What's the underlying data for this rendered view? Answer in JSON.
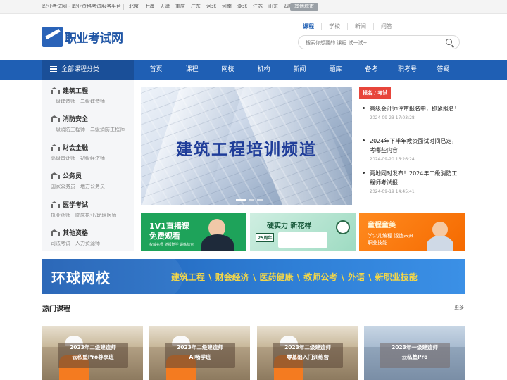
{
  "topbar": {
    "site_text": "职业考试网 - 职业资格考试服务平台",
    "cities": [
      "北京",
      "上海",
      "天津",
      "重庆",
      "广东",
      "河北",
      "河南",
      "湖北",
      "江苏",
      "山东",
      "四川"
    ],
    "more_city": "其他城市"
  },
  "logo": {
    "text": "职业考试网"
  },
  "header_tabs": [
    "课程",
    "学校",
    "新闻",
    "问答"
  ],
  "search": {
    "placeholder": "搜索你想要的 课程 试一试~"
  },
  "nav": {
    "all_categories": "全部课程分类",
    "items": [
      "首页",
      "课程",
      "网校",
      "机构",
      "新闻",
      "题库",
      "备考",
      "职考号",
      "答疑"
    ]
  },
  "sidebar": {
    "categories": [
      {
        "title": "建筑工程",
        "subs": [
          "一级建造师",
          "二级建造师"
        ]
      },
      {
        "title": "消防安全",
        "subs": [
          "一级消防工程师",
          "二级消防工程师"
        ]
      },
      {
        "title": "财会金融",
        "subs": [
          "高级审计师",
          "初级经济师"
        ]
      },
      {
        "title": "公务员",
        "subs": [
          "国家公务员",
          "地方公务员"
        ]
      },
      {
        "title": "医学考试",
        "subs": [
          "执业药师",
          "临床执业/助理医师"
        ]
      },
      {
        "title": "其他资格",
        "subs": [
          "司法考试",
          "人力资源师"
        ]
      }
    ]
  },
  "banner": {
    "title": "建筑工程培训频道"
  },
  "news": {
    "tag": "报名 / 考试",
    "items": [
      {
        "title": "高级会计师评审报名中，抓紧报名！",
        "time": "2024-09-23 17:03:28"
      },
      {
        "title": "2024年下半年教资面试时间已定，考哪些内容",
        "time": "2024-09-20 16:26:24"
      },
      {
        "title": "两地同时发布！2024年二级消防工程师考试报",
        "time": "2024-09-19 14:45:41"
      }
    ]
  },
  "promos": [
    {
      "headline": "1V1直播课",
      "headline2": "免费观看",
      "sub": "权威名师  随报随学  讲练结合"
    },
    {
      "headline": "硬实力 新花样",
      "sub": "25周年"
    },
    {
      "headline": "童程童美",
      "sub": "学少儿编程 锻造未来职业技能"
    }
  ],
  "wide_banner": {
    "brand": "环球网校",
    "categories": "建筑工程 \\ 财会经济 \\ 医药健康 \\ 教师公考 \\ 外语 \\ 新职业技能"
  },
  "hot": {
    "title": "热门课程",
    "more": "更多",
    "courses": [
      {
        "line1": "2023年二级建造师",
        "line2": "云私塾Pro尊享班"
      },
      {
        "line1": "2023年二级建造师",
        "line2": "AI畅学班"
      },
      {
        "line1": "2023年二级建造师",
        "line2": "零基础入门训练营"
      },
      {
        "line1": "2023年一级建造师",
        "line2": "云私塾Pro"
      }
    ]
  }
}
